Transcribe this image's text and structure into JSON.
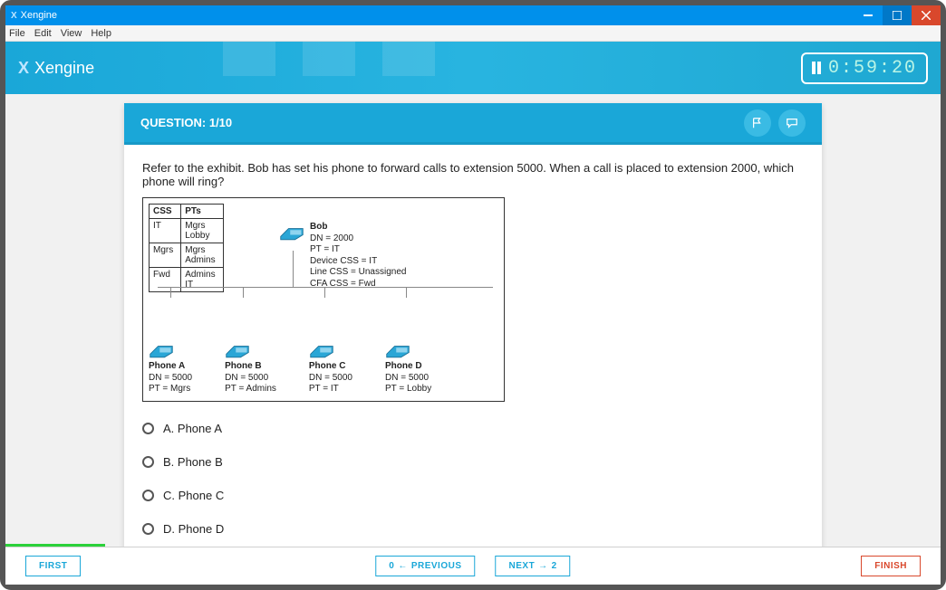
{
  "window": {
    "title": "Xengine"
  },
  "menu": {
    "file": "File",
    "edit": "Edit",
    "view": "View",
    "help": "Help"
  },
  "banner": {
    "title": "Xengine",
    "timer": "0:59:20"
  },
  "question": {
    "header": "QUESTION: 1/10",
    "text": "Refer to the exhibit. Bob has set his phone to forward calls to extension 5000. When a call is placed to extension 2000, which phone will ring?"
  },
  "exhibit": {
    "headers": {
      "css": "CSS",
      "pts": "PTs"
    },
    "rows": [
      {
        "css": "IT",
        "pts": "Mgrs\nLobby"
      },
      {
        "css": "Mgrs",
        "pts": "Mgrs\nAdmins"
      },
      {
        "css": "Fwd",
        "pts": "Admins\nIT"
      }
    ],
    "bob": {
      "name": "Bob",
      "l1": "DN = 2000",
      "l2": "PT = IT",
      "l3": "Device CSS = IT",
      "l4": "Line CSS = Unassigned",
      "l5": "CFA CSS = Fwd"
    },
    "phones": [
      {
        "name": "Phone A",
        "dn": "DN = 5000",
        "pt": "PT = Mgrs"
      },
      {
        "name": "Phone B",
        "dn": "DN = 5000",
        "pt": "PT = Admins"
      },
      {
        "name": "Phone C",
        "dn": "DN = 5000",
        "pt": "PT = IT"
      },
      {
        "name": "Phone D",
        "dn": "DN = 5000",
        "pt": "PT = Lobby"
      }
    ]
  },
  "options": {
    "a": "A. Phone A",
    "b": "B. Phone B",
    "c": "C. Phone C",
    "d": "D. Phone D"
  },
  "footer": {
    "first": "FIRST",
    "prev_num": "0",
    "prev": "PREVIOUS",
    "next": "NEXT",
    "next_num": "2",
    "finish": "FINISH"
  }
}
